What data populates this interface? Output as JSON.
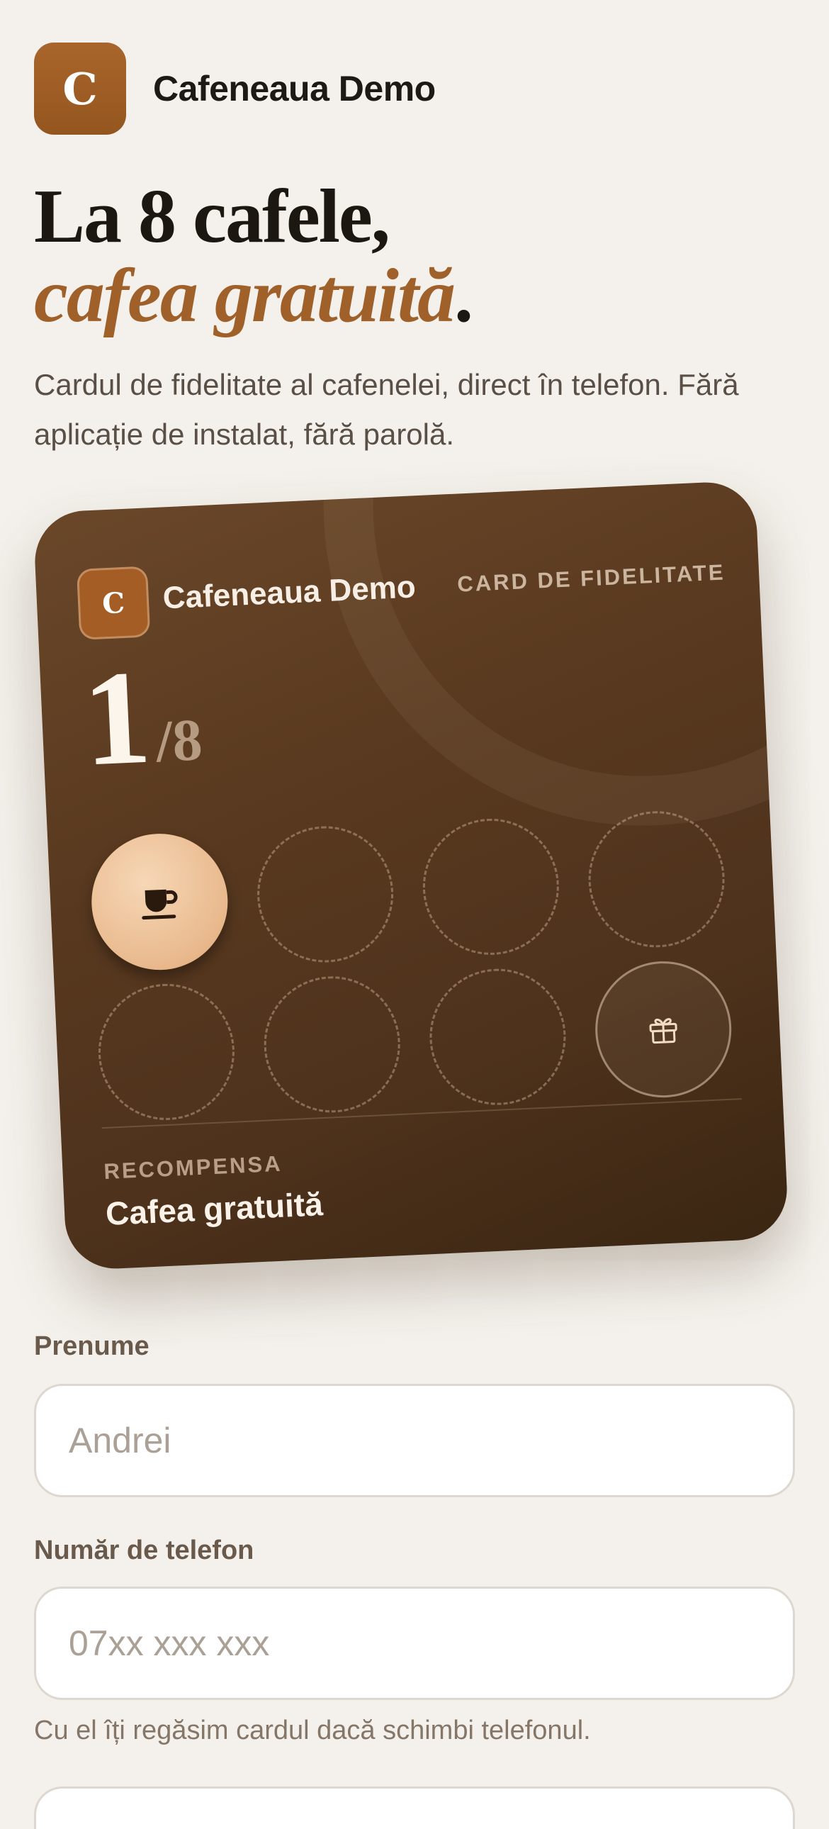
{
  "brand": {
    "logo_letter": "C",
    "name": "Cafeneaua Demo"
  },
  "hero": {
    "title_line1": "La 8 cafele,",
    "title_accent": "cafea gratuită",
    "title_end": ".",
    "subtitle": "Cardul de fidelitate al cafenelei, direct în telefon. Fără aplicație de instalat, fără parolă."
  },
  "card": {
    "logo_letter": "C",
    "name": "Cafeneaua Demo",
    "type_label": "CARD DE FIDELITATE",
    "stamps_collected": "1",
    "stamps_total": "/8",
    "stamps": [
      {
        "state": "filled",
        "icon": "coffee-cup-icon"
      },
      {
        "state": "empty"
      },
      {
        "state": "empty"
      },
      {
        "state": "empty"
      },
      {
        "state": "empty"
      },
      {
        "state": "empty"
      },
      {
        "state": "empty"
      },
      {
        "state": "reward",
        "icon": "gift-icon"
      }
    ],
    "reward_label": "RECOMPENSA",
    "reward_value": "Cafea gratuită"
  },
  "form": {
    "first_name": {
      "label": "Prenume",
      "placeholder": "Andrei",
      "value": ""
    },
    "phone": {
      "label": "Număr de telefon",
      "placeholder": "07xx xxx xxx",
      "value": "",
      "helper": "Cu el îți regăsim cardul dacă schimbi telefonul."
    }
  },
  "colors": {
    "background": "#f4f1ec",
    "accent": "#a0602a",
    "card_dark": "#4e321c",
    "stamp_filled": "#e9b98d"
  }
}
